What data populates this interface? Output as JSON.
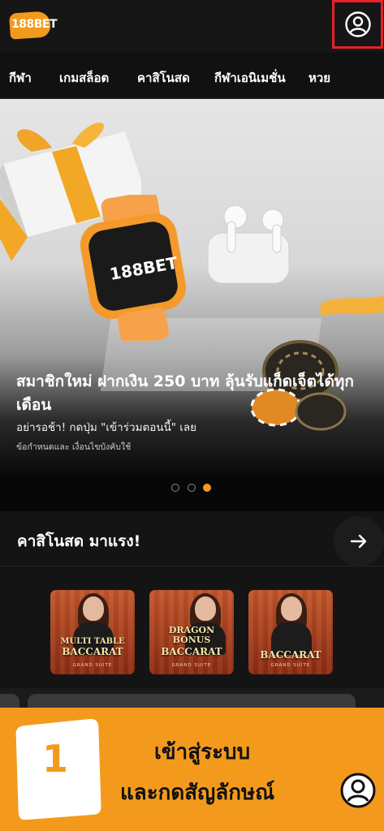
{
  "header": {
    "logo_text": "188BET",
    "account_icon": "user-circle-icon"
  },
  "nav": {
    "items": [
      "กีฬา",
      "เกมสล็อต",
      "คาสิโนสด",
      "กีฬาเอนิเมชั่น",
      "หวย"
    ]
  },
  "banner": {
    "title": "สมาชิกใหม่ ฝากเงิน 250 บาท ลุ้นรับแก็ดเจ็ตได้ทุกเดือน",
    "subtitle": "อย่ารอช้า! กดปุ่ม \"เข้าร่วมตอนนี้\" เลย",
    "terms": "ข้อกำหนดและ เงื่อนไขบังคับใช้",
    "watch_brand": "188BET",
    "slide_count": 3,
    "active_slide": 3
  },
  "live_casino": {
    "title": "คาสิโนสด มาแรง!",
    "arrow_icon": "arrow-right-icon",
    "games": [
      {
        "title_line1": "MULTI TABLE",
        "title_line2": "BACCARAT",
        "title_line3": "",
        "subtitle": "GRAND SUITE"
      },
      {
        "title_line1": "DRAGON",
        "title_line2": "BONUS",
        "title_line3": "BACCARAT",
        "subtitle": "GRAND SUITE"
      },
      {
        "title_line1": "BACCARAT",
        "title_line2": "",
        "title_line3": "",
        "subtitle": "GRAND SUITE"
      }
    ]
  },
  "instruction": {
    "step_number": "1",
    "line1": "เข้าสู่ระบบ",
    "line2": "และกดสัญลักษณ์",
    "icon": "user-circle-icon"
  },
  "colors": {
    "accent": "#f39a1d",
    "highlight_border": "#e8212a",
    "background": "#0f0f10"
  }
}
